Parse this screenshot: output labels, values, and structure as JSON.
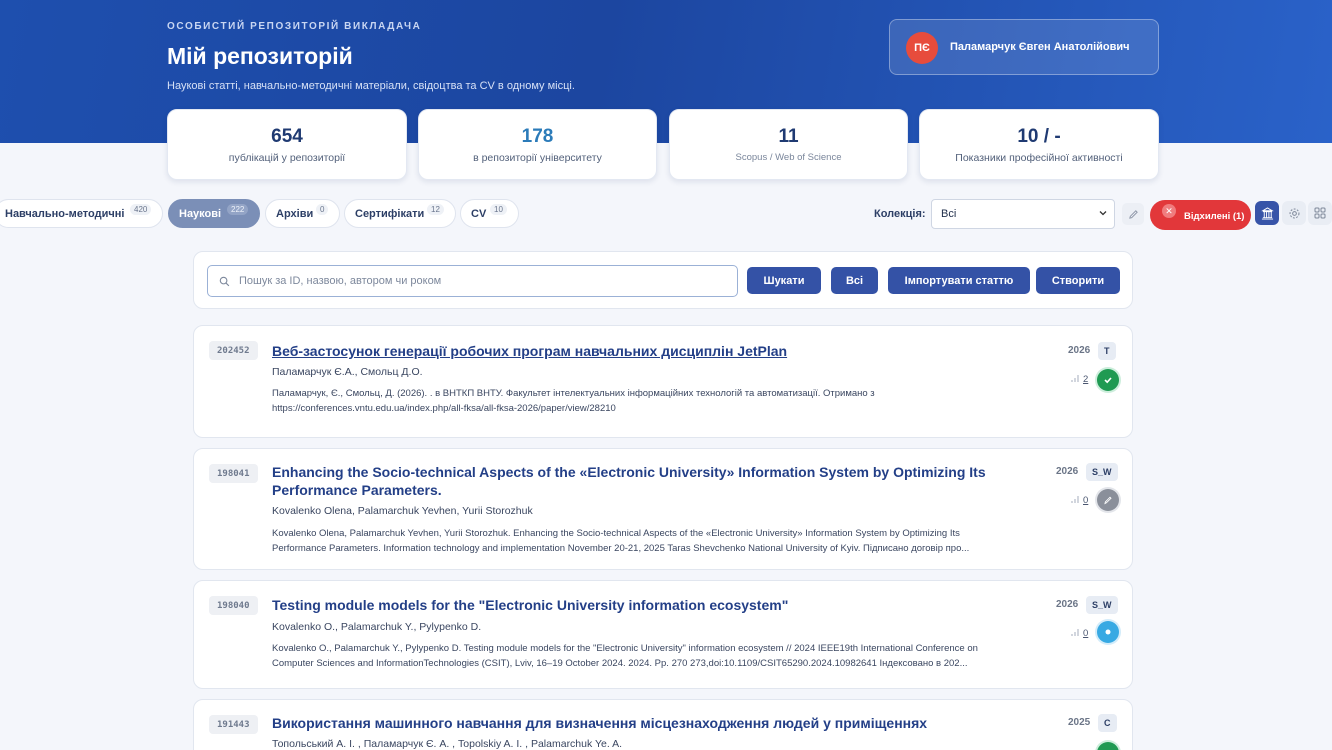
{
  "header": {
    "eyebrow": "ОСОБИСТИЙ РЕПОЗИТОРІЙ ВИКЛАДАЧА",
    "title": "Мій репозиторій",
    "subtitle": "Наукові статті, навчально-методичні матеріали, свідоцтва та CV в одному місці."
  },
  "user": {
    "initials": "ПЄ",
    "name": "Паламарчук Євген Анатолійович",
    "avatar_color": "#e74c3c"
  },
  "stats": [
    {
      "value": "654",
      "label": "публікацій у репозиторії"
    },
    {
      "value": "178",
      "label": "в репозиторії університету"
    },
    {
      "value": "11",
      "label": "Scopus / Web of Science"
    },
    {
      "value": "10 / -",
      "label": "Показники професійної активності"
    }
  ],
  "tabs": [
    {
      "label": "Навчально-методичні",
      "count": "420"
    },
    {
      "label": "Наукові",
      "count": "222",
      "active": true
    },
    {
      "label": "Архіви",
      "count": "0"
    },
    {
      "label": "Сертифікати",
      "count": "12"
    },
    {
      "label": "CV",
      "count": "10"
    }
  ],
  "collection": {
    "label": "Колекція:",
    "selected": "Всі"
  },
  "rejected": {
    "label": "Відхилені (1)",
    "color": "#e2373a"
  },
  "search": {
    "placeholder": "Пошук за ID, назвою, автором чи роком",
    "search_btn": "Шукати",
    "all_btn": "Всі",
    "import_btn": "Імпортувати статтю",
    "create_btn": "Створити"
  },
  "publications": [
    {
      "id": "202452",
      "title": "Веб-застосунок генерації робочих програм навчальних дисциплін JetPlan",
      "authors": "Паламарчук Є.А., Смольц Д.О.",
      "citation": "Паламарчук, Є., Смольц, Д. (2026). . в ВНТКП ВНТУ. Факультет інтелектуальних інформаційних технологій та автоматизації. Отримано з https://conferences.vntu.edu.ua/index.php/all-fksa/all-fksa-2026/paper/view/28210",
      "year": "2026",
      "type": "T",
      "views": "2",
      "status": "approved"
    },
    {
      "id": "198041",
      "title": "Enhancing the Socio-technical Aspects of the «Electronic University» Information System by Optimizing Its Performance Parameters.",
      "authors": "Kovalenko Olena, Palamarchuk Yevhen, Yurii Storozhuk",
      "citation": "Kovalenko Olena, Palamarchuk Yevhen, Yurii Storozhuk. Enhancing the Socio-technical Aspects of the «Electronic University» Information System by Optimizing Its Performance Parameters. Information technology and implementation November 20-21, 2025 Taras Shevchenko National University of Kyiv. Підписано договір про...",
      "year": "2026",
      "type": "S_W",
      "views": "0",
      "status": "draft"
    },
    {
      "id": "198040",
      "title": "Testing module models for the \"Electronic University information ecosystem\"",
      "authors": "Kovalenko O., Palamarchuk Y., Pylypenko D.",
      "citation": "Kovalenko O., Palamarchuk Y., Pylypenko D. Testing module models for the \"Electronic University\" information ecosystem // 2024 IEEE19th International Conference on Computer Sciences and InformationTechnologies (CSIT), Lviv, 16–19 October 2024. 2024. Pp. 270  273,doi:10.1109/CSIT65290.2024.10982641 Індексовано в 202...",
      "year": "2026",
      "type": "S_W",
      "views": "0",
      "status": "pending"
    },
    {
      "id": "191443",
      "title": "Використання машинного навчання для визначення місцезнаходження людей у приміщеннях",
      "authors": "Топольський А. І. , Паламарчук Є. А. , Topolskiy A. I. , Palamarchuk Ye. A.",
      "year": "2025",
      "type": "C"
    }
  ]
}
